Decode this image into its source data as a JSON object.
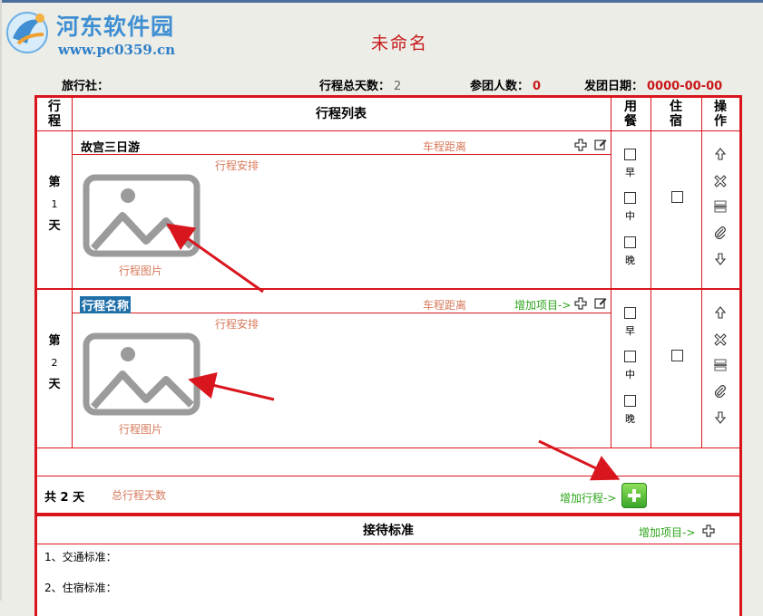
{
  "watermark": {
    "title": "河东软件园",
    "url": "www.pc0359.cn"
  },
  "document": {
    "title": "未命名"
  },
  "info_bar": {
    "agency_label": "旅行社：",
    "total_days_label": "行程总天数：",
    "total_days_value": "2",
    "group_size_label": "参团人数：",
    "group_size_value": "0",
    "departure_label": "发团日期：",
    "departure_value": "0000-00-00"
  },
  "table_header": {
    "itinerary": "行程",
    "list": "行程列表",
    "meals": "用餐",
    "stay": "住宿",
    "ops": "操作"
  },
  "days": [
    {
      "label_top": "第",
      "number": "1",
      "label_bottom": "天",
      "trip_name": "故宫三日游",
      "distance": "车程距离",
      "arrange": "行程安排",
      "image_caption": "行程图片",
      "add_item": ""
    },
    {
      "label_top": "第",
      "number": "2",
      "label_bottom": "天",
      "trip_name": "行程名称",
      "distance": "车程距离",
      "arrange": "行程安排",
      "image_caption": "行程图片",
      "add_item": "增加项目->"
    }
  ],
  "meals": {
    "breakfast": "早",
    "lunch": "中",
    "dinner": "晚"
  },
  "summary": {
    "prefix": "共",
    "count": "2",
    "suffix": "天",
    "note": "总行程天数",
    "add_trip": "增加行程->"
  },
  "standards": {
    "title": "接待标准",
    "add_item": "增加项目->",
    "items": [
      "1、交通标准：",
      "2、住宿标准："
    ]
  },
  "colors": {
    "accent_red": "#d9161e",
    "title_red": "#c8191b",
    "label_orange": "#d77a5c",
    "green": "#2ea51c",
    "watermark_blue": "#3f8fd2"
  }
}
